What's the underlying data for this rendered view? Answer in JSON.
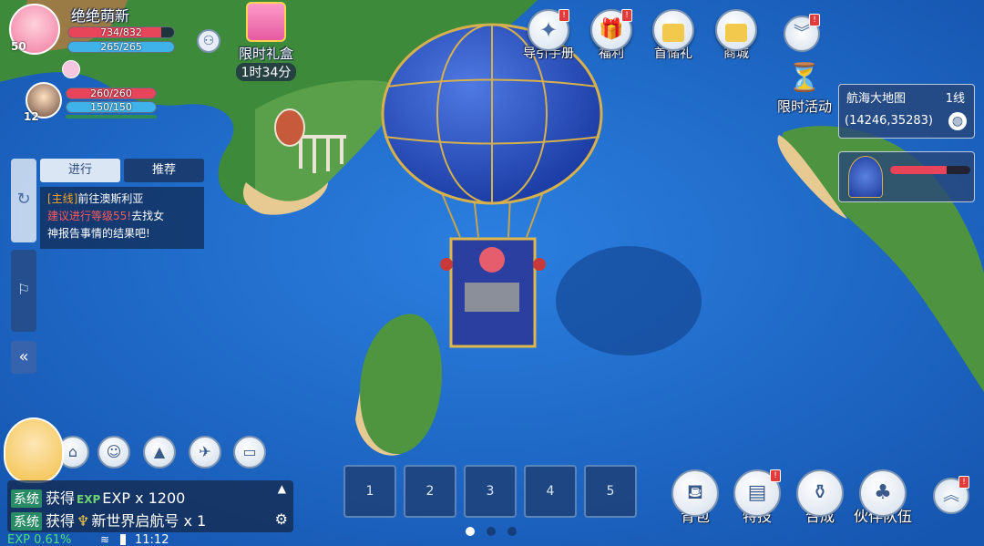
{
  "player": {
    "name": "绝绝萌新",
    "level": "50",
    "hp": "734/832",
    "hp_fraction": 0.88,
    "mp": "265/265",
    "mp_fraction": 1.0
  },
  "partner": {
    "level": "12",
    "hp": "260/260",
    "hp_fraction": 1.0,
    "mp": "150/150",
    "mp_fraction": 1.0
  },
  "gift": {
    "label": "限时礼盒",
    "timer": "1时34分"
  },
  "top_menu": [
    {
      "label": "导引手册",
      "icon": "compass-icon",
      "badge": "!"
    },
    {
      "label": "福利",
      "icon": "gift-box-icon",
      "badge": "!"
    },
    {
      "label": "首储礼",
      "icon": "shopping-bag-icon",
      "badge": ""
    },
    {
      "label": "商城",
      "icon": "shopping-bag-star-icon",
      "badge": ""
    }
  ],
  "limited_event": {
    "label": "限时活动",
    "icon": "hourglass-icon"
  },
  "map": {
    "name": "航海大地图",
    "line": "1线",
    "coords": "(14246,35283)"
  },
  "airship_hp_fraction": 0.7,
  "quest": {
    "tabs": [
      "进行",
      "推荐"
    ],
    "tag": "[主线]",
    "title": "前往澳斯利亚",
    "desc_highlight": "建议进行等级55!",
    "desc_rest_1": "去找女",
    "desc_rest_2": "神报告事情的结果吧!"
  },
  "skill_slots": [
    "1",
    "2",
    "3",
    "4",
    "5"
  ],
  "bottom_menu": [
    {
      "label": "背包",
      "icon": "backpack-icon",
      "badge": ""
    },
    {
      "label": "特技",
      "icon": "book-icon",
      "badge": "!"
    },
    {
      "label": "合成",
      "icon": "pot-icon",
      "badge": ""
    },
    {
      "label": "伙伴队伍",
      "icon": "team-icon",
      "badge": ""
    }
  ],
  "chat": {
    "lines": [
      {
        "tag": "系统",
        "text": "获得",
        "exp_tag": "EXP",
        "item": "EXP x 1200"
      },
      {
        "tag": "系统",
        "text": "获得",
        "item": "新世界启航号 x 1"
      }
    ]
  },
  "status": {
    "exp": "EXP 0.61%",
    "time": "11:12"
  },
  "colors": {
    "ocean": "#1d6fd0",
    "hp": "#e8455a",
    "mp": "#3fb2ea",
    "system_tag": "#2a8c67",
    "highlight": "#ff5a5a"
  }
}
